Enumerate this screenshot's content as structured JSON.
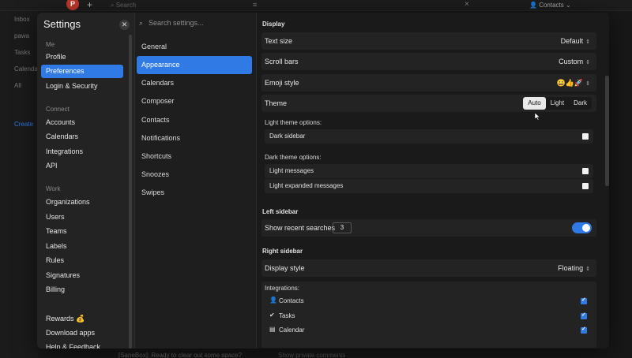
{
  "background": {
    "avatar_letter": "P",
    "search_placeholder": "Search",
    "contacts_label": "Contacts",
    "sidebar": [
      "Inbox",
      "pawa",
      "Tasks",
      "Calendar",
      "All",
      "Create"
    ],
    "bottom_text": "[SaneBox]: Ready to clear out some space?",
    "bottom_right": "Show private comments"
  },
  "settings": {
    "title": "Settings",
    "search_placeholder": "Search settings...",
    "sections": {
      "me": "Me",
      "connect": "Connect",
      "work": "Work"
    },
    "me_items": [
      "Profile",
      "Preferences",
      "Login & Security"
    ],
    "connect_items": [
      "Accounts",
      "Calendars",
      "Integrations",
      "API"
    ],
    "work_items": [
      "Organizations",
      "Users",
      "Teams",
      "Labels",
      "Rules",
      "Signatures",
      "Billing"
    ],
    "bottom_items": [
      "Rewards 💰",
      "Download apps",
      "Help & Feedback"
    ],
    "categories": [
      "General",
      "Appearance",
      "Calendars",
      "Composer",
      "Contacts",
      "Notifications",
      "Shortcuts",
      "Snoozes",
      "Swipes"
    ]
  },
  "display": {
    "title": "Display",
    "text_size_label": "Text size",
    "text_size_value": "Default",
    "scroll_bars_label": "Scroll bars",
    "scroll_bars_value": "Custom",
    "emoji_label": "Emoji style",
    "emoji_value": "😀👍🚀",
    "theme_label": "Theme",
    "theme_options": [
      "Auto",
      "Light",
      "Dark"
    ],
    "light_options_title": "Light theme options:",
    "dark_sidebar_label": "Dark sidebar",
    "dark_options_title": "Dark theme options:",
    "light_messages_label": "Light messages",
    "light_expanded_label": "Light expanded messages"
  },
  "left_sidebar": {
    "title": "Left sidebar",
    "recent_label": "Show recent searches",
    "recent_value": "3",
    "recent_enabled": true
  },
  "right_sidebar": {
    "title": "Right sidebar",
    "display_style_label": "Display style",
    "display_style_value": "Floating",
    "integrations_title": "Integrations:",
    "integrations": [
      "Contacts",
      "Tasks",
      "Calendar"
    ]
  },
  "colors": {
    "accent": "#2f7ae5",
    "panel": "#1e1e1e",
    "row": "#232323"
  }
}
